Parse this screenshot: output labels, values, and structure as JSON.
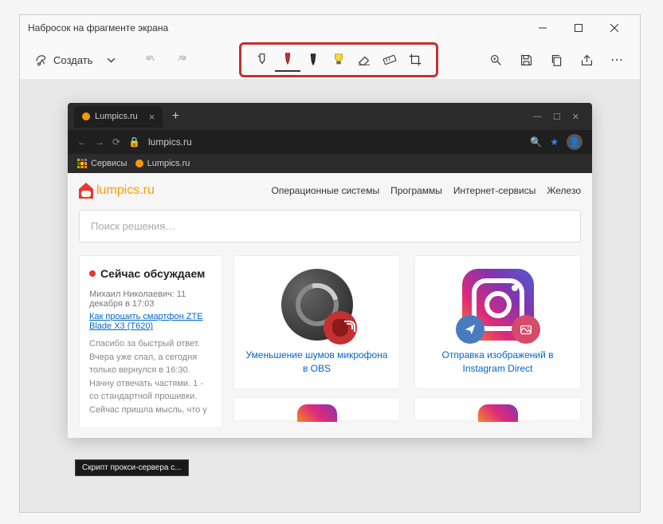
{
  "window": {
    "title": "Набросок на фрагменте экрана",
    "minimize": "—",
    "maximize": "☐",
    "close": "✕"
  },
  "toolbar": {
    "create": "Создать",
    "tools": {
      "touch": "touch-writing",
      "pen_red": "ballpoint-pen",
      "pen_black": "pencil",
      "highlighter": "highlighter",
      "eraser": "eraser",
      "ruler": "ruler",
      "crop": "crop"
    },
    "right": {
      "zoom": "zoom",
      "save": "save",
      "copy": "copy",
      "share": "share",
      "more": "⋯"
    }
  },
  "browser": {
    "tab_title": "Lumpics.ru",
    "url": "lumpics.ru",
    "bookmarks": {
      "services": "Сервисы",
      "lumpics": "Lumpics.ru"
    }
  },
  "page": {
    "logo": "lumpics.ru",
    "menu": {
      "os": "Операционные системы",
      "programs": "Программы",
      "internet": "Интернет-сервисы",
      "hw": "Железо"
    },
    "search_placeholder": "Поиск решения…",
    "sidebar": {
      "title": "Сейчас обсуждаем",
      "meta": "Михаил Николаевич: 11 декабря в 17:03",
      "link": "Как прошить смартфон ZTE Blade X3 (T620)",
      "body": "Спасибо за быстрый ответ. Вчера уже спал, а сегодня только вернулся в 16:30. Начну отвечать частями. 1 - со стандартной прошивки. Сейчас пришла мысль, что у"
    },
    "card1": "Уменьшение шумов микрофона в OBS",
    "card2": "Отправка изображений в Instagram Direct"
  },
  "tooltip": "Скрипт прокси-сервера с..."
}
